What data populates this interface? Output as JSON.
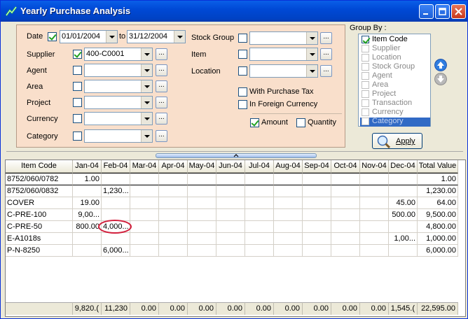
{
  "window": {
    "title": "Yearly Purchase Analysis"
  },
  "filters": {
    "date": {
      "label": "Date",
      "checked": true,
      "from": "01/01/2004",
      "to_label": "to",
      "to": "31/12/2004"
    },
    "supplier": {
      "label": "Supplier",
      "checked": true,
      "value": "400-C0001"
    },
    "agent": {
      "label": "Agent",
      "checked": false,
      "value": ""
    },
    "area": {
      "label": "Area",
      "checked": false,
      "value": ""
    },
    "project": {
      "label": "Project",
      "checked": false,
      "value": ""
    },
    "currency": {
      "label": "Currency",
      "checked": false,
      "value": ""
    },
    "category": {
      "label": "Category",
      "checked": false,
      "value": ""
    },
    "stock_group": {
      "label": "Stock Group",
      "checked": false,
      "value": ""
    },
    "item": {
      "label": "Item",
      "checked": false,
      "value": ""
    },
    "location": {
      "label": "Location",
      "checked": false,
      "value": ""
    },
    "with_purchase_tax": {
      "label": "With Purchase Tax",
      "checked": false
    },
    "in_foreign_currency": {
      "label": "In Foreign Currency",
      "checked": false
    },
    "amount": {
      "label": "Amount",
      "checked": true
    },
    "quantity": {
      "label": "Quantity",
      "checked": false
    },
    "ellipsis": "..."
  },
  "group_by": {
    "label": "Group By :",
    "items": [
      {
        "label": "Item Code",
        "checked": true,
        "enabled": true
      },
      {
        "label": "Supplier",
        "checked": false,
        "enabled": false
      },
      {
        "label": "Location",
        "checked": false,
        "enabled": false
      },
      {
        "label": "Stock Group",
        "checked": false,
        "enabled": false
      },
      {
        "label": "Agent",
        "checked": false,
        "enabled": false
      },
      {
        "label": "Area",
        "checked": false,
        "enabled": false
      },
      {
        "label": "Project",
        "checked": false,
        "enabled": false
      },
      {
        "label": "Transaction",
        "checked": false,
        "enabled": false
      },
      {
        "label": "Currency",
        "checked": false,
        "enabled": false
      },
      {
        "label": "Category",
        "checked": false,
        "enabled": false,
        "selected": true
      }
    ],
    "apply_label": "Apply"
  },
  "grid": {
    "columns": [
      "Item Code",
      "Jan-04",
      "Feb-04",
      "Mar-04",
      "Apr-04",
      "May-04",
      "Jun-04",
      "Jul-04",
      "Aug-04",
      "Sep-04",
      "Oct-04",
      "Nov-04",
      "Dec-04",
      "Total Value"
    ],
    "rows": [
      [
        "8752/060/0782",
        "1.00",
        "",
        "",
        "",
        "",
        "",
        "",
        "",
        "",
        "",
        "",
        "",
        "1.00"
      ],
      [
        "8752/060/0832",
        "",
        "1,230...",
        "",
        "",
        "",
        "",
        "",
        "",
        "",
        "",
        "",
        "",
        "1,230.00"
      ],
      [
        "COVER",
        "19.00",
        "",
        "",
        "",
        "",
        "",
        "",
        "",
        "",
        "",
        "",
        "45.00",
        "64.00"
      ],
      [
        "C-PRE-100",
        "9,00...",
        "",
        "",
        "",
        "",
        "",
        "",
        "",
        "",
        "",
        "",
        "500.00",
        "9,500.00"
      ],
      [
        "C-PRE-50",
        "800.00",
        "4,000...",
        "",
        "",
        "",
        "",
        "",
        "",
        "",
        "",
        "",
        "",
        "4,800.00"
      ],
      [
        "E-A1018s",
        "",
        "",
        "",
        "",
        "",
        "",
        "",
        "",
        "",
        "",
        "",
        "1,00...",
        "1,000.00"
      ],
      [
        "P-N-8250",
        "",
        "6,000...",
        "",
        "",
        "",
        "",
        "",
        "",
        "",
        "",
        "",
        "",
        "6,000.00"
      ]
    ],
    "totals": [
      "",
      "9,820.(",
      "11,230",
      "0.00",
      "0.00",
      "0.00",
      "0.00",
      "0.00",
      "0.00",
      "0.00",
      "0.00",
      "0.00",
      "1,545.(",
      "22,595.00"
    ]
  }
}
